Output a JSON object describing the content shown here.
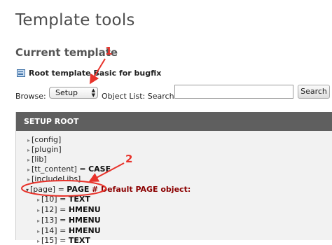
{
  "page_title": "Template tools",
  "section_title": "Current template",
  "template": {
    "name": "Root template Basic for bugfix"
  },
  "browse": {
    "label": "Browse:",
    "selected": "Setup",
    "arrows": "▲▼"
  },
  "object_list": {
    "label": "Object List:",
    "search_label": "Search:",
    "search_value": "",
    "button": "Search"
  },
  "panel": {
    "header": "SETUP ROOT"
  },
  "tree": [
    {
      "key": "[config]"
    },
    {
      "key": "[plugin]"
    },
    {
      "key": "[lib]"
    },
    {
      "key": "[tt_content]",
      "eq": " = ",
      "value": "CASE"
    },
    {
      "key": "[includeLibs]"
    },
    {
      "key": "[page]",
      "eq": " = ",
      "value": "PAGE",
      "comment": "# Default PAGE object:"
    },
    {
      "key": "[10]",
      "eq": " = ",
      "value": "TEXT"
    },
    {
      "key": "[12]",
      "eq": " = ",
      "value": "HMENU"
    },
    {
      "key": "[13]",
      "eq": " = ",
      "value": "HMENU"
    },
    {
      "key": "[14]",
      "eq": " = ",
      "value": "HMENU"
    },
    {
      "key": "[15]",
      "eq": " = ",
      "value": "TEXT"
    }
  ],
  "annotations": {
    "one": "1",
    "two": "2"
  },
  "colors": {
    "annotation": "#e8332b",
    "header_bg": "#5f5f5f",
    "panel_bg": "#f2f2f2",
    "comment": "#8b0000"
  }
}
